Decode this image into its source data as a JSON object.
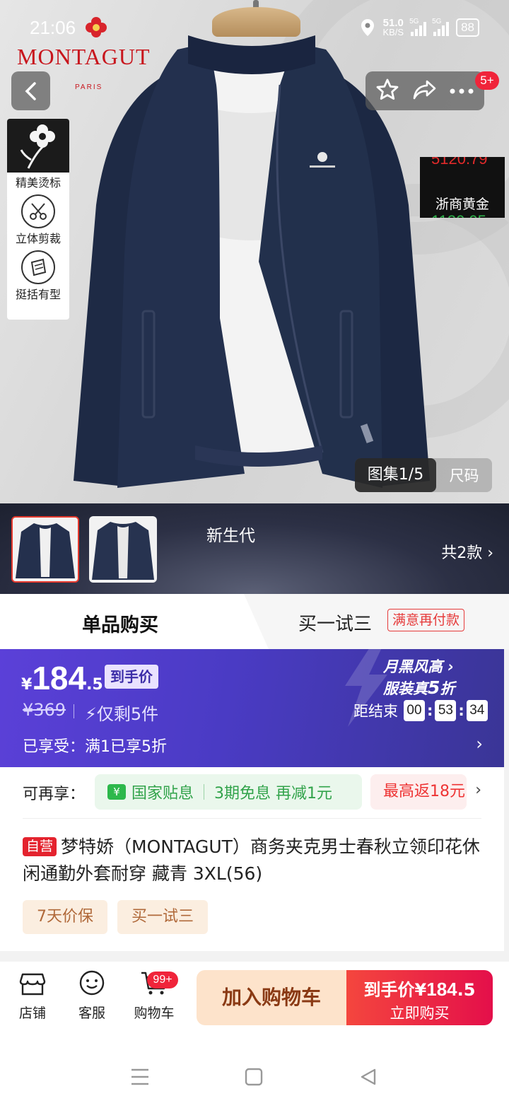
{
  "status_bar": {
    "time": "21:06",
    "net_speed": "51.0",
    "net_unit": "KB/S",
    "signal_1": "5G",
    "signal_2": "5G",
    "battery": "88"
  },
  "brand": {
    "name": "MONTAGUT",
    "sub": "PARIS"
  },
  "top_actions": {
    "more_badge": "5+"
  },
  "features": [
    {
      "label": "精美烫标",
      "icon": "flower-patch-icon"
    },
    {
      "label": "立体剪裁",
      "icon": "scissors-icon"
    },
    {
      "label": "挺括有型",
      "icon": "fabric-icon"
    }
  ],
  "gold_ticker": {
    "top": "5120.79",
    "label": "浙商黄金",
    "bottom": "1130.05"
  },
  "gallery": {
    "label": "图集1/5",
    "size": "尺码"
  },
  "thumb_strip": {
    "generation": "新生代",
    "variants": "共2款 ›"
  },
  "purchase_tabs": {
    "single": "单品购买",
    "try_label": "买一试三",
    "try_tag": "满意再付款"
  },
  "price": {
    "currency": "¥",
    "integer": "184",
    "decimal": ".5",
    "tag": "到手价",
    "original": "¥369",
    "stock": "⚡仅剩5件",
    "promo_line1": "月黑风高 ›",
    "promo_line2a": "服装真",
    "promo_line2b": "5",
    "promo_line2c": "折",
    "countdown_label": "距结束",
    "hh": "00",
    "mm": "53",
    "ss": "34",
    "enjoyed": "已享受：满1已享5折",
    "enjoyed_arrow": "›"
  },
  "offers": {
    "label": "可再享：",
    "green_icon": "¥",
    "green_1": "国家贴息",
    "green_2": "3期免息 再减1元",
    "red": "最高返18元",
    "arrow": "›"
  },
  "product": {
    "self_tag": "自营",
    "title": "梦特娇（MONTAGUT）商务夹克男士春秋立领印花休闲通勤外套耐穿 藏青 3XL(56)",
    "chips": [
      "7天价保",
      "买一试三"
    ]
  },
  "bottom_bar": {
    "shop": "店铺",
    "service": "客服",
    "cart": "购物车",
    "cart_badge": "99+",
    "add_cart": "加入购物车",
    "buy_price_label": "到手价¥",
    "buy_price_int": "184",
    "buy_price_dec": ".5",
    "buy_now": "立即购买"
  },
  "colors": {
    "brand_red": "#c8161d",
    "promo_purple": "#4a3bc4",
    "buy_red": "#e40f4a",
    "green": "#31a34a"
  }
}
